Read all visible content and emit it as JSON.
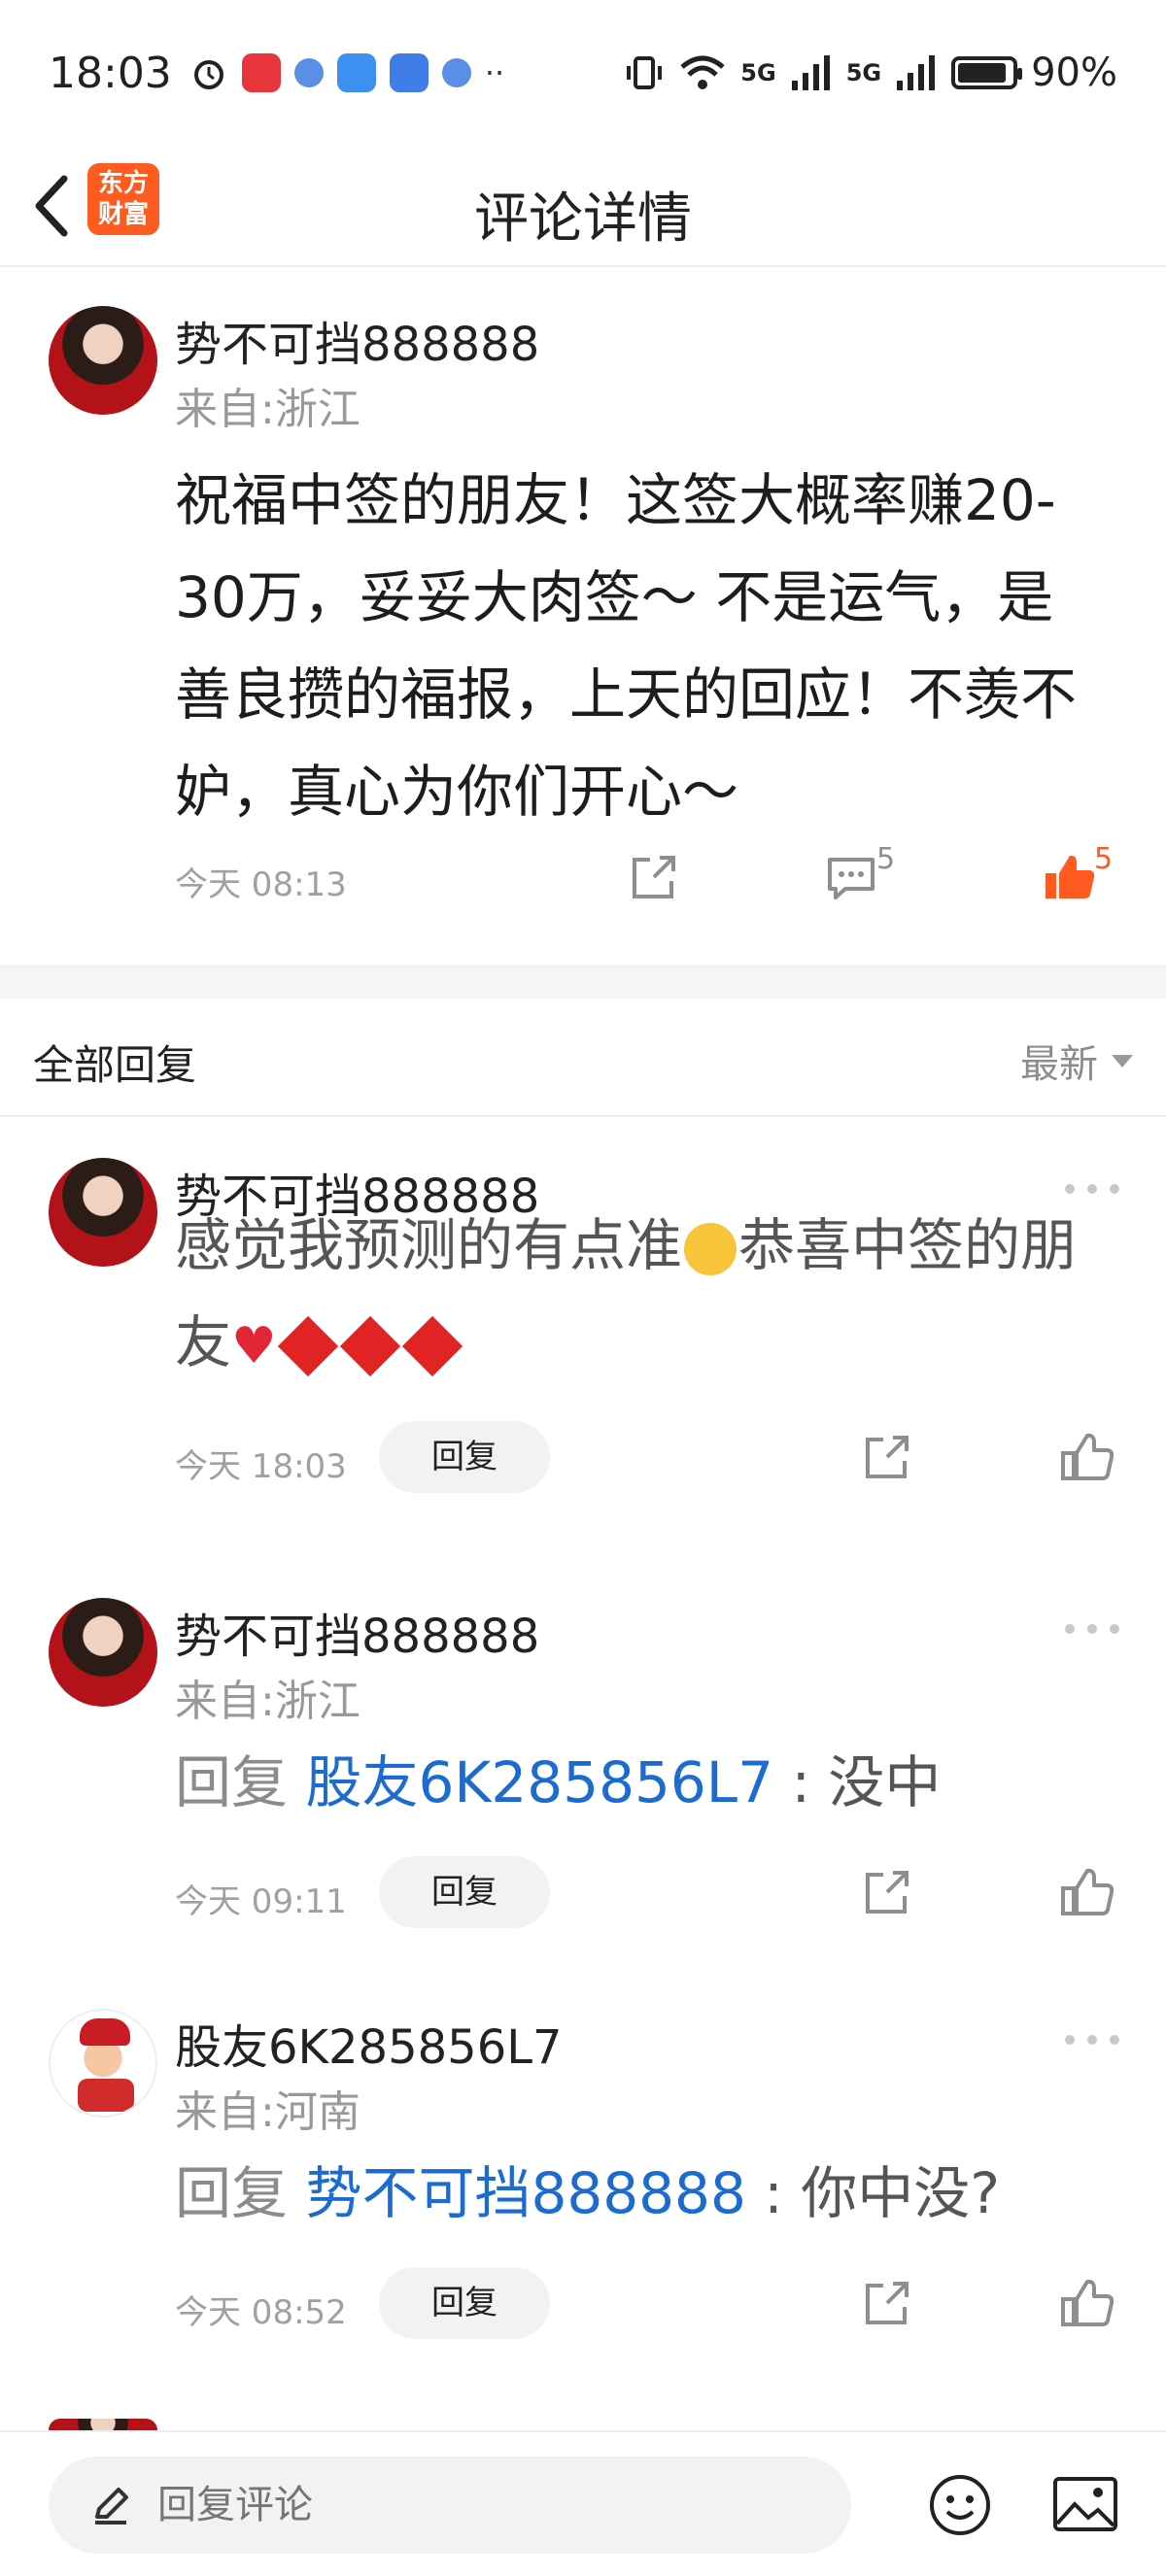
{
  "status_bar": {
    "time": "18:03",
    "network_1": "5G",
    "network_2": "5G",
    "battery_text": "90%",
    "battery_level": 0.9
  },
  "header": {
    "title": "评论详情",
    "logo_line1": "东方",
    "logo_line2": "财富"
  },
  "main_comment": {
    "username": "势不可挡888888",
    "location": "来自:浙江",
    "text": "祝福中签的朋友！这签大概率赚20-30万，妥妥大肉签～ 不是运气，是善良攒的福报，上天的回应！不羡不妒，真心为你们开心～",
    "time": "今天 08:13",
    "comment_count": "5",
    "like_count": "5"
  },
  "replies": {
    "section_title": "全部回复",
    "sort_label": "最新",
    "reply_button_label": "回复",
    "items": [
      {
        "username": "势不可挡888888",
        "text_part1": "感觉我预测的有点准",
        "text_part2": "恭喜中签的朋友",
        "time": "今天 18:03"
      },
      {
        "username": "势不可挡888888",
        "location": "来自:浙江",
        "prefix": "回复",
        "mention": "股友6K285856L7",
        "text": " : 没中",
        "time": "今天 09:11"
      },
      {
        "username": "股友6K285856L7",
        "location": "来自:河南",
        "prefix": "回复",
        "mention": "势不可挡888888",
        "text": " : 你中没?",
        "time": "今天 08:52"
      }
    ]
  },
  "bottom_bar": {
    "input_placeholder": "回复评论"
  },
  "colors": {
    "accent_orange": "#ff5a1f",
    "mention_blue": "#1c6bd0",
    "muted_gray": "#999999"
  },
  "icons": [
    "alarm-icon",
    "wifi-icon",
    "signal-icon",
    "battery-icon",
    "back-icon",
    "share-icon",
    "comment-icon",
    "thumbs-up-icon",
    "more-icon",
    "pencil-icon",
    "emoji-icon",
    "image-icon"
  ]
}
